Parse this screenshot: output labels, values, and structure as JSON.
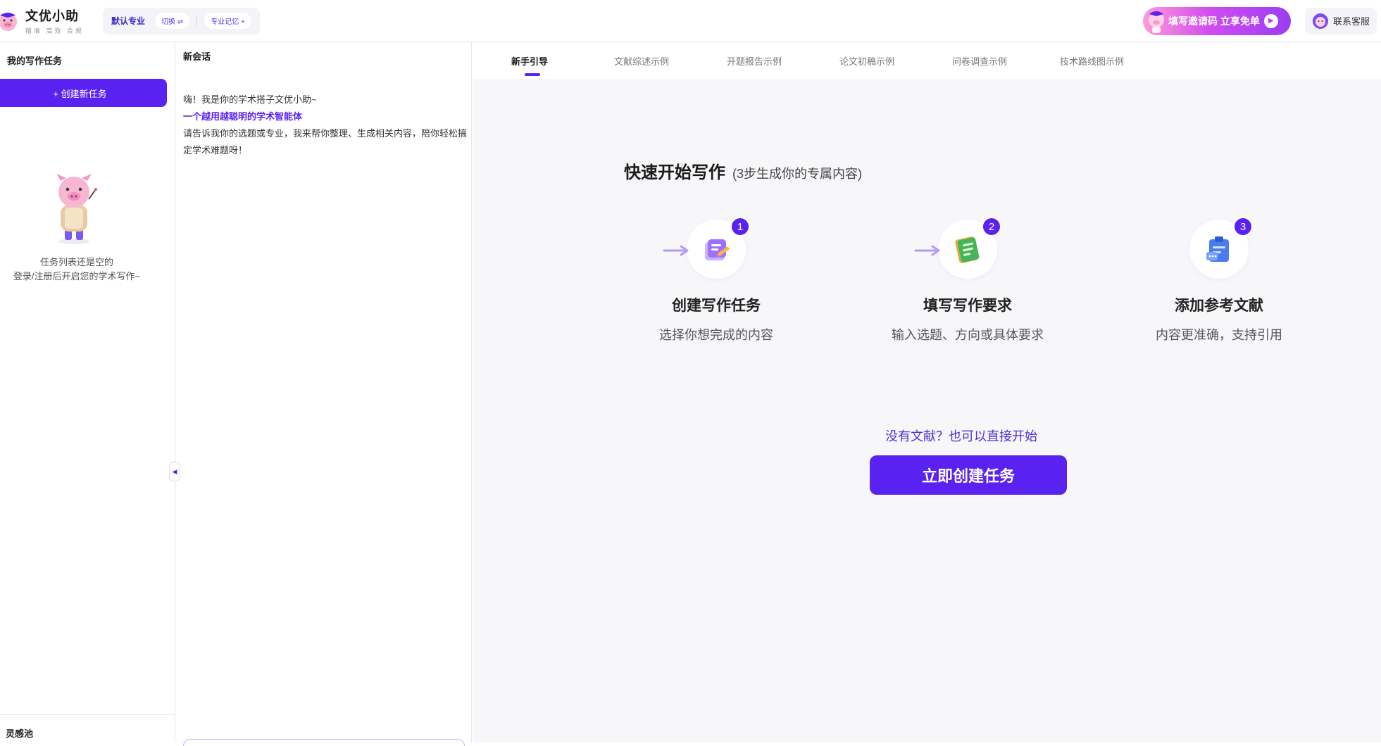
{
  "header": {
    "logo_title": "文优小助",
    "logo_subtitle": "精准 高效 合规",
    "major_label": "默认专业",
    "switch_label": "切换 ⇌",
    "memory_label": "专业记忆 +",
    "invite_text": "填写邀请码 立享免单",
    "contact_label": "联系客服"
  },
  "task_panel": {
    "title": "我的写作任务",
    "create_button": "+ 创建新任务",
    "empty_line1": "任务列表还是空的",
    "empty_line2": "登录/注册后开启您的学术写作~",
    "inspiration_label": "灵感池"
  },
  "chat": {
    "title": "新会话",
    "greeting": "嗨！我是你的学术搭子文优小助~",
    "tagline": "一个越用越聪明的学术智能体",
    "body": "请告诉我你的选题或专业，我来帮你整理、生成相关内容，陪你轻松搞定学术难题呀！"
  },
  "tabs": [
    {
      "label": "新手引导",
      "active": true
    },
    {
      "label": "文献综述示例",
      "active": false
    },
    {
      "label": "开题报告示例",
      "active": false
    },
    {
      "label": "论文初稿示例",
      "active": false
    },
    {
      "label": "问卷调查示例",
      "active": false
    },
    {
      "label": "技术路线图示例",
      "active": false
    }
  ],
  "guide": {
    "title": "快速开始写作",
    "subtitle": "(3步生成你的专属内容)",
    "steps": [
      {
        "number": "1",
        "title": "创建写作任务",
        "desc": "选择你想完成的内容",
        "icon": "create-task-icon"
      },
      {
        "number": "2",
        "title": "填写写作要求",
        "desc": "输入选题、方向或具体要求",
        "icon": "requirements-icon"
      },
      {
        "number": "3",
        "title": "添加参考文献",
        "desc": "内容更准确，支持引用",
        "icon": "references-icon"
      }
    ],
    "no_reference_text": "没有文献？也可以直接开始",
    "start_button": "立即创建任务"
  },
  "colors": {
    "accent": "#5a22f0",
    "background": "#f7f7fa",
    "arrow": "#b39af5"
  }
}
